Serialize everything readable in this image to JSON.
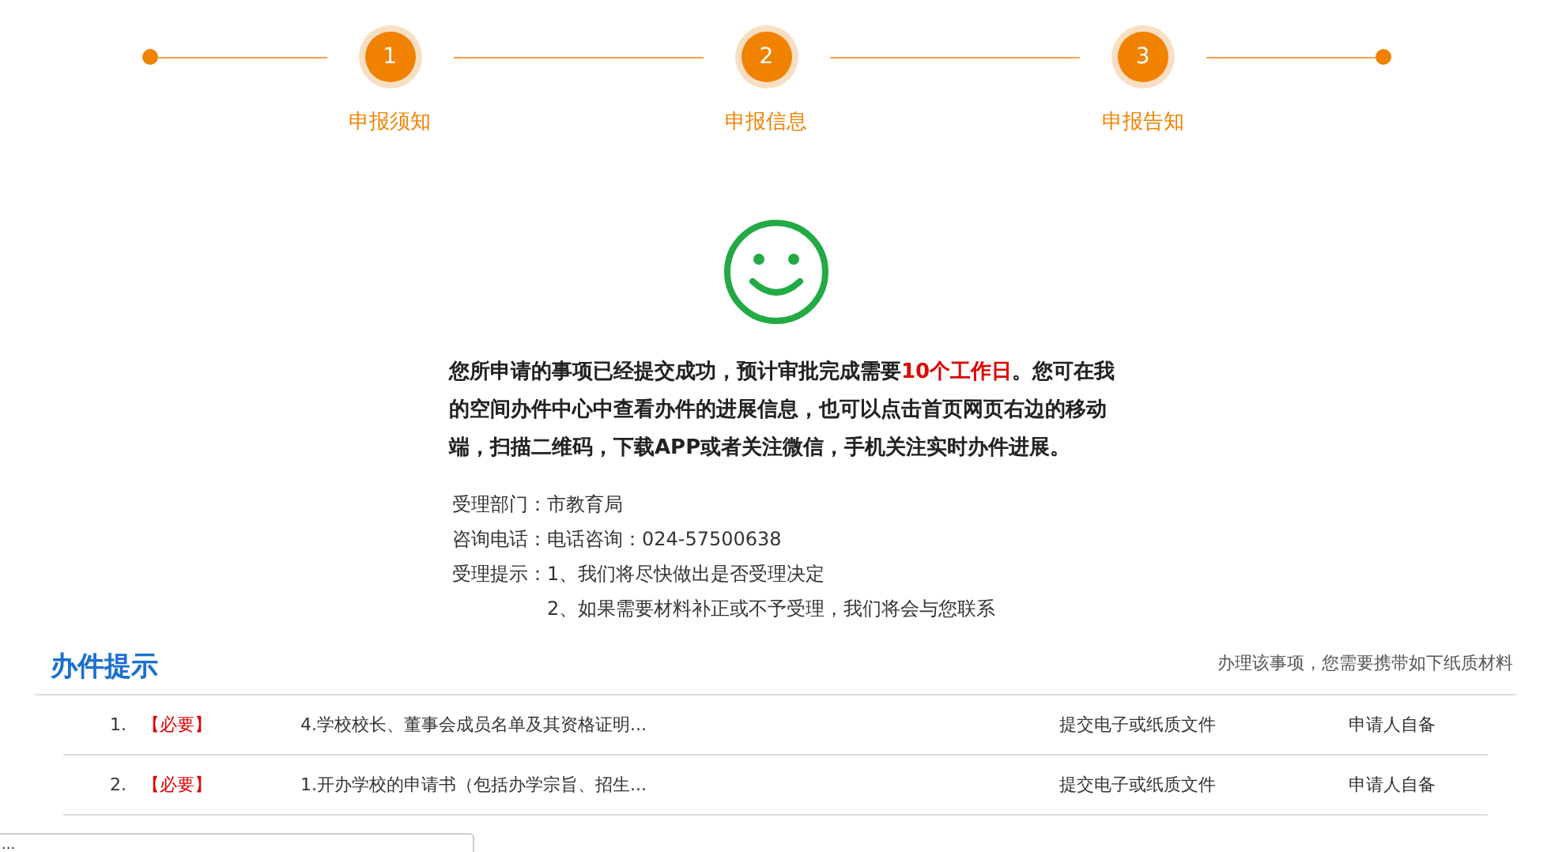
{
  "steps": [
    {
      "number": "1",
      "label": "申报须知"
    },
    {
      "number": "2",
      "label": "申报信息"
    },
    {
      "number": "3",
      "label": "申报告知"
    }
  ],
  "message": [
    {
      "text": "您所申请的事项已经提交成功，预计审批完成需要",
      "highlight": false
    },
    {
      "text": "10个工作日",
      "highlight": true
    },
    {
      "text": "。您可在我的空间办件中心中查看办件的进展信息，也可以点击首页网页右边的移动端，扫描二维码，下载APP或者关注微信，手机关注实时办件进展。",
      "highlight": false
    }
  ],
  "info": [
    {
      "label": "受理部门：",
      "lines": [
        "市教育局"
      ]
    },
    {
      "label": "咨询电话：",
      "lines": [
        "电话咨询：024-57500638"
      ]
    },
    {
      "label": "受理提示：",
      "lines": [
        "1、我们将尽快做出是否受理决定",
        "2、如果需要材料补正或不予受理，我们将会与您联系"
      ]
    }
  ],
  "tips": {
    "title": "办件提示",
    "note": "办理该事项，您需要携带如下纸质材料",
    "rows": [
      {
        "index": "1.",
        "tag": "【必要】",
        "name": "4.学校校长、董事会成员名单及其资格证明...",
        "form": "提交电子或纸质文件",
        "source": "申请人自备"
      },
      {
        "index": "2.",
        "tag": "【必要】",
        "name": "1.开办学校的申请书（包括办学宗旨、招生...",
        "form": "提交电子或纸质文件",
        "source": "申请人自备"
      }
    ]
  },
  "popup": {
    "text": "..."
  }
}
